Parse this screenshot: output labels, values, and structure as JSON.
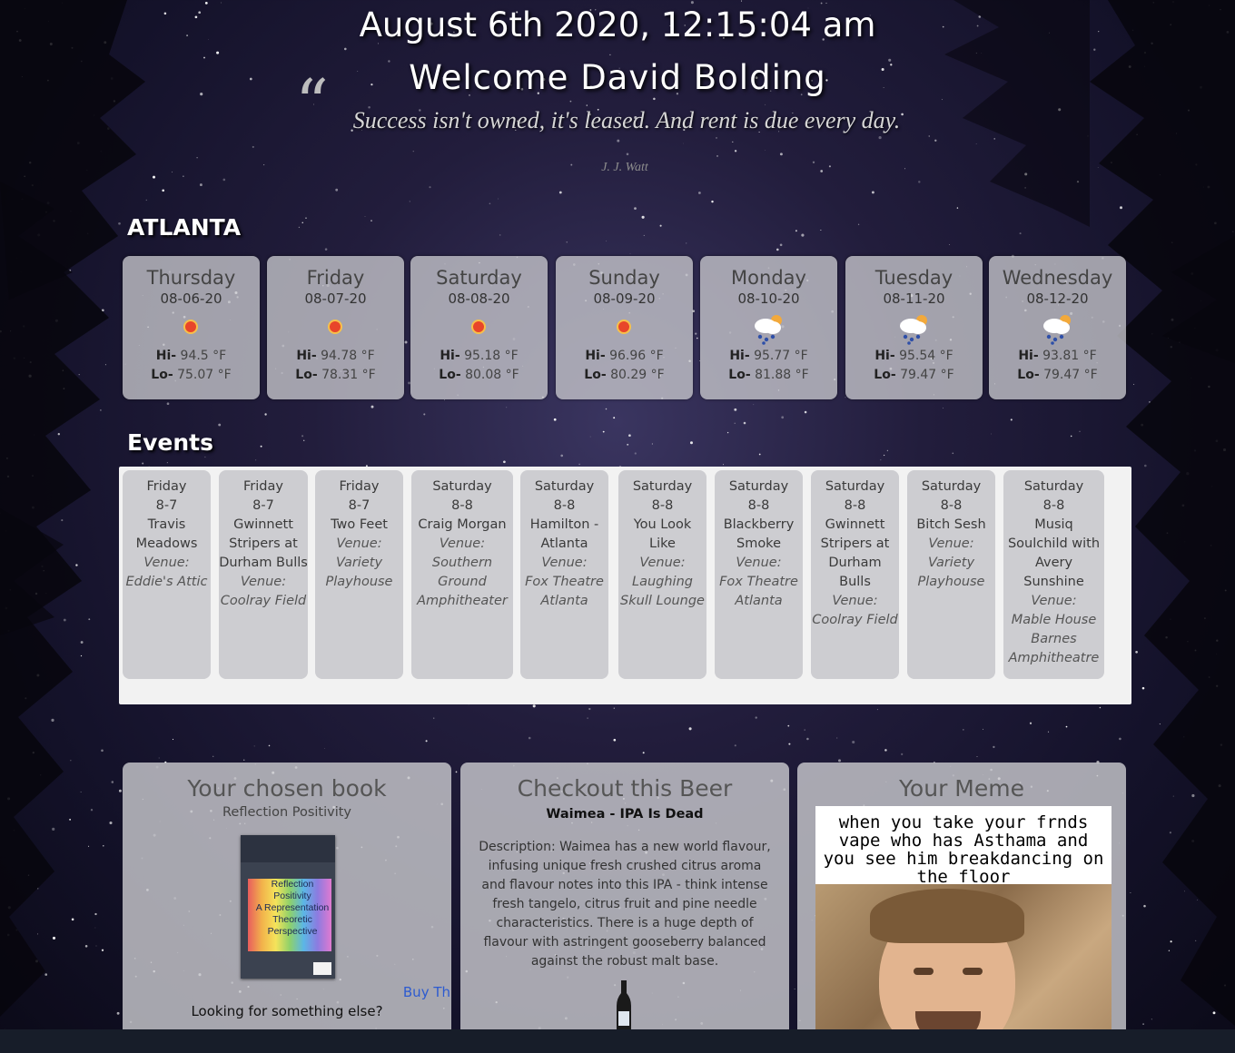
{
  "header": {
    "datetime": "August 6th 2020, 12:15:04 am",
    "welcome": "Welcome David Bolding"
  },
  "quote": {
    "mark": "“",
    "text": "Success isn't owned, it's leased. And rent is due every day.",
    "author": "J. J. Watt"
  },
  "weather": {
    "city": "ATLANTA",
    "hi_label": "Hi-",
    "lo_label": "Lo-",
    "days": [
      {
        "day": "Thursday",
        "date": "08-06-20",
        "icon": "sun-icon",
        "hi": "94.5 °F",
        "lo": "75.07 °F"
      },
      {
        "day": "Friday",
        "date": "08-07-20",
        "icon": "sun-icon",
        "hi": "94.78 °F",
        "lo": "78.31 °F"
      },
      {
        "day": "Saturday",
        "date": "08-08-20",
        "icon": "sun-icon",
        "hi": "95.18 °F",
        "lo": "80.08 °F"
      },
      {
        "day": "Sunday",
        "date": "08-09-20",
        "icon": "sun-icon",
        "hi": "96.96 °F",
        "lo": "80.29 °F"
      },
      {
        "day": "Monday",
        "date": "08-10-20",
        "icon": "rain-cloud-icon",
        "hi": "95.77 °F",
        "lo": "81.88 °F"
      },
      {
        "day": "Tuesday",
        "date": "08-11-20",
        "icon": "rain-cloud-icon",
        "hi": "95.54 °F",
        "lo": "79.47 °F"
      },
      {
        "day": "Wednesday",
        "date": "08-12-20",
        "icon": "rain-cloud-icon",
        "hi": "93.81 °F",
        "lo": "79.47 °F"
      }
    ]
  },
  "events": {
    "title": "Events",
    "venue_label": "Venue:",
    "items": [
      {
        "day": "Friday",
        "date": "8-7",
        "name": "Travis Meadows",
        "venue": "Eddie's Attic"
      },
      {
        "day": "Friday",
        "date": "8-7",
        "name": "Gwinnett Stripers at Durham Bulls",
        "venue": "Coolray Field"
      },
      {
        "day": "Friday",
        "date": "8-7",
        "name": "Two Feet",
        "venue": "Variety Playhouse"
      },
      {
        "day": "Saturday",
        "date": "8-8",
        "name": "Craig Morgan",
        "venue": "Southern Ground Amphitheater"
      },
      {
        "day": "Saturday",
        "date": "8-8",
        "name": "Hamilton - Atlanta",
        "venue": "Fox Theatre Atlanta"
      },
      {
        "day": "Saturday",
        "date": "8-8",
        "name": "You Look Like",
        "venue": "Laughing Skull Lounge"
      },
      {
        "day": "Saturday",
        "date": "8-8",
        "name": "Blackberry Smoke",
        "venue": "Fox Theatre Atlanta"
      },
      {
        "day": "Saturday",
        "date": "8-8",
        "name": "Gwinnett Stripers at Durham Bulls",
        "venue": "Coolray Field"
      },
      {
        "day": "Saturday",
        "date": "8-8",
        "name": "Bitch Sesh",
        "venue": "Variety Playhouse"
      },
      {
        "day": "Saturday",
        "date": "8-8",
        "name": "Musiq Soulchild with Avery Sunshine",
        "venue": "Mable House Barnes Amphitheatre"
      }
    ]
  },
  "book": {
    "title": "Your chosen book",
    "subtitle": "Reflection Positivity",
    "cover_lines": [
      "Reflection",
      "Positivity",
      "A Representation",
      "Theoretic",
      "Perspective"
    ],
    "buy_label": "Buy This Book",
    "else_label": "Looking for something else?"
  },
  "beer": {
    "title": "Checkout this Beer",
    "name": "Waimea - IPA Is Dead",
    "description": "Description: Waimea has a new world flavour, infusing unique fresh crushed citrus aroma and flavour notes into this IPA - think intense fresh tangelo, citrus fruit and pine needle characteristics. There is a huge depth of flavour with astringent gooseberry balanced against the robust malt base."
  },
  "meme": {
    "title": "Your Meme",
    "caption": "when you take your frnds vape who has Asthama and you see him breakdancing on the floor"
  },
  "colors": {
    "card_bg": "#c8c8cd",
    "link": "#2d5bd0",
    "sun": "#e8452a"
  }
}
